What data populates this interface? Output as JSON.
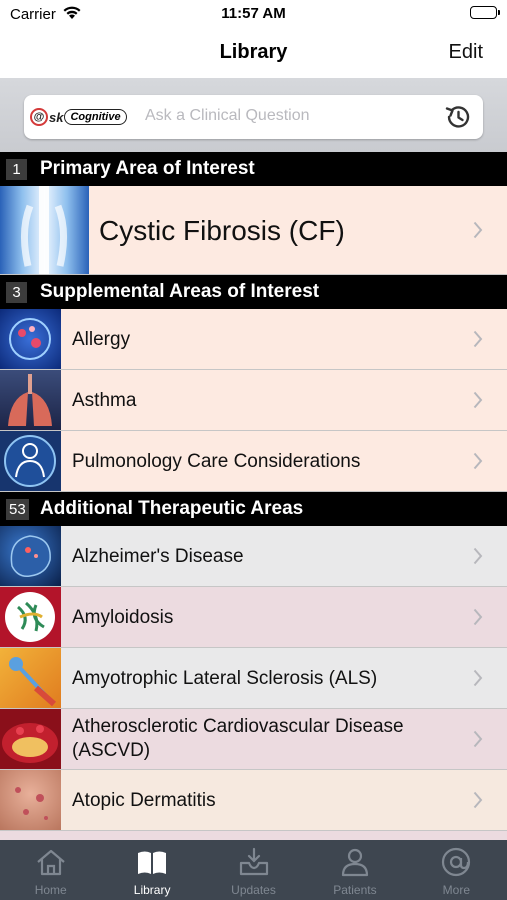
{
  "status": {
    "carrier": "Carrier",
    "time": "11:57 AM"
  },
  "nav": {
    "title": "Library",
    "edit": "Edit"
  },
  "search": {
    "logo_ask": "sk",
    "logo_cognitive": "Cognitive",
    "placeholder": "Ask a Clinical Question"
  },
  "primary": {
    "count": "1",
    "header": "Primary Area of Interest",
    "item": "Cystic Fibrosis (CF)"
  },
  "supplemental": {
    "count": "3",
    "header": "Supplemental Areas of Interest",
    "items": [
      "Allergy",
      "Asthma",
      "Pulmonology Care Considerations"
    ]
  },
  "additional": {
    "count": "53",
    "header": "Additional Therapeutic Areas",
    "items": [
      "Alzheimer's Disease",
      "Amyloidosis",
      "Amyotrophic Lateral Sclerosis (ALS)",
      "Atherosclerotic Cardiovascular Disease (ASCVD)",
      "Atopic Dermatitis"
    ]
  },
  "tabs": [
    {
      "label": "Home",
      "icon": "home-icon",
      "active": false
    },
    {
      "label": "Library",
      "icon": "book-icon",
      "active": true
    },
    {
      "label": "Updates",
      "icon": "inbox-icon",
      "active": false
    },
    {
      "label": "Patients",
      "icon": "person-icon",
      "active": false
    },
    {
      "label": "More",
      "icon": "at-icon",
      "active": false
    }
  ],
  "colors": {
    "row_peach": "#fdeae1",
    "row_gray": "#e9e9ea",
    "row_pink": "#ecdbe0",
    "row_beige": "#f6e9df",
    "section_bg": "#000000",
    "tabbar_bg": "#3e4650"
  }
}
